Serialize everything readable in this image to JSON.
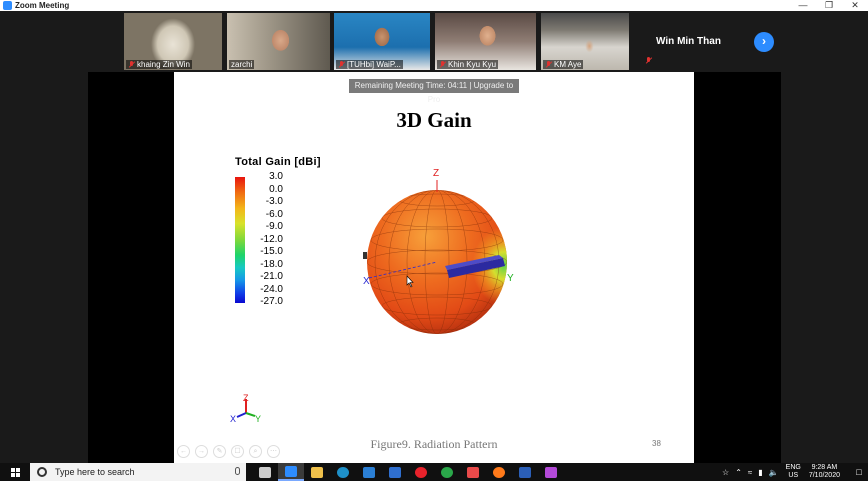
{
  "window": {
    "title": "Zoom Meeting",
    "controls": [
      "—",
      "❐",
      "✕"
    ]
  },
  "participants": [
    {
      "name": "khaing Zin Win",
      "muted": true
    },
    {
      "name": "zarchi",
      "muted": false
    },
    {
      "name": "[TUHbi] WaiP...",
      "muted": true
    },
    {
      "name": "Khin Kyu Kyu",
      "muted": true
    },
    {
      "name": "KM Aye",
      "muted": true
    }
  ],
  "textonly_participant": {
    "name": "Win Min Than",
    "muted": true
  },
  "gallery_next_icon": "chevron-right-icon",
  "banner": "Remaining Meeting Time: 04:11 | Upgrade to Pro",
  "slide": {
    "title": "3D Gain",
    "legend_title": "Total Gain [dBi]",
    "legend_ticks": [
      "3.0",
      "0.0",
      "-3.0",
      "-6.0",
      "-9.0",
      "-12.0",
      "-15.0",
      "-18.0",
      "-21.0",
      "-24.0",
      "-27.0"
    ],
    "axis_labels": {
      "z": "Z",
      "x": "X",
      "y": "Y"
    },
    "caption": "Figure9. Radiation Pattern",
    "page_number": "38",
    "controls": [
      "←",
      "→",
      "✎",
      "☐",
      "⌕",
      "⋯"
    ]
  },
  "taskbar": {
    "search_placeholder": "Type here to search",
    "apps": [
      "task-view",
      "zoom",
      "file-explorer",
      "edge",
      "store",
      "mail",
      "opera",
      "chrome-canary",
      "paint",
      "firefox",
      "word",
      "other"
    ],
    "app_colors": [
      "#cccccc",
      "#2d8cff",
      "#f0c14b",
      "#1e90c8",
      "#2b7fd4",
      "#2f6fcf",
      "#e8222b",
      "#2aa84a",
      "#e84a4a",
      "#ff7a1a",
      "#2b5fb8",
      "#b44ad9"
    ],
    "lang": [
      "ENG",
      "US"
    ],
    "time": "9:28 AM",
    "date": "7/10/2020"
  }
}
